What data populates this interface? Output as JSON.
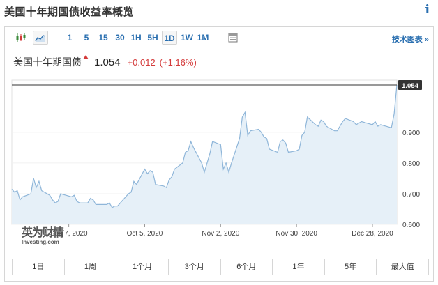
{
  "page": {
    "title": "美国十年期国债收益率概览",
    "info_icon": "i"
  },
  "toolbar": {
    "chart_type_icons": [
      "candlestick-icon",
      "area-chart-icon"
    ],
    "timeframes": [
      "1",
      "5",
      "15",
      "30",
      "1H",
      "5H",
      "1D",
      "1W",
      "1M"
    ],
    "active_timeframe": "1D",
    "settings_icon": "table-icon",
    "tech_chart_label": "技术图表 »"
  },
  "quote": {
    "name": "美国十年期国债",
    "price": "1.054",
    "change": "+0.012",
    "change_pct": "(+1.16%)",
    "direction": "up"
  },
  "watermark": {
    "cn": "英为财情",
    "en": "Investing.com"
  },
  "range_buttons": [
    "1日",
    "1周",
    "1个月",
    "3个月",
    "6个月",
    "1年",
    "5年",
    "最大值"
  ],
  "colors": {
    "up": "#d43a3a",
    "link": "#2a6fb0",
    "line": "#8fb6d9",
    "area": "#e6f0f8"
  },
  "chart_data": {
    "type": "area",
    "title": "",
    "xlabel": "",
    "ylabel": "",
    "ylim": [
      0.6,
      1.07
    ],
    "y_ticks": [
      0.6,
      0.7,
      0.8,
      0.9
    ],
    "y_tick_labels": [
      "0.600",
      "0.700",
      "0.800",
      "0.900"
    ],
    "x_ticks": [
      "2020-09-07",
      "2020-10-05",
      "2020-11-02",
      "2020-11-30",
      "2020-12-28"
    ],
    "x_tick_labels": [
      "Sep 7, 2020",
      "Oct 5, 2020",
      "Nov 2, 2020",
      "Nov 30, 2020",
      "Dec 28, 2020"
    ],
    "last_value_label": "1.054",
    "reference_line": 1.054,
    "series": [
      {
        "x": [
          "2020-08-17",
          "2020-08-18",
          "2020-08-19",
          "2020-08-20",
          "2020-08-21",
          "2020-08-24",
          "2020-08-25",
          "2020-08-26",
          "2020-08-27",
          "2020-08-28",
          "2020-08-31",
          "2020-09-01",
          "2020-09-02",
          "2020-09-03",
          "2020-09-04",
          "2020-09-08",
          "2020-09-09",
          "2020-09-10",
          "2020-09-11",
          "2020-09-14",
          "2020-09-15",
          "2020-09-16",
          "2020-09-17",
          "2020-09-18",
          "2020-09-21",
          "2020-09-22",
          "2020-09-23",
          "2020-09-24",
          "2020-09-25",
          "2020-09-28",
          "2020-09-29",
          "2020-09-30",
          "2020-10-01",
          "2020-10-02",
          "2020-10-05",
          "2020-10-06",
          "2020-10-07",
          "2020-10-08",
          "2020-10-09",
          "2020-10-12",
          "2020-10-13",
          "2020-10-14",
          "2020-10-15",
          "2020-10-16",
          "2020-10-19",
          "2020-10-20",
          "2020-10-21",
          "2020-10-22",
          "2020-10-23",
          "2020-10-26",
          "2020-10-27",
          "2020-10-28",
          "2020-10-29",
          "2020-10-30",
          "2020-11-02",
          "2020-11-03",
          "2020-11-04",
          "2020-11-05",
          "2020-11-06",
          "2020-11-09",
          "2020-11-10",
          "2020-11-11",
          "2020-11-12",
          "2020-11-13",
          "2020-11-16",
          "2020-11-17",
          "2020-11-18",
          "2020-11-19",
          "2020-11-20",
          "2020-11-23",
          "2020-11-24",
          "2020-11-25",
          "2020-11-26",
          "2020-11-27",
          "2020-11-30",
          "2020-12-01",
          "2020-12-02",
          "2020-12-03",
          "2020-12-04",
          "2020-12-07",
          "2020-12-08",
          "2020-12-09",
          "2020-12-10",
          "2020-12-11",
          "2020-12-14",
          "2020-12-15",
          "2020-12-16",
          "2020-12-17",
          "2020-12-18",
          "2020-12-21",
          "2020-12-22",
          "2020-12-23",
          "2020-12-24",
          "2020-12-28",
          "2020-12-29",
          "2020-12-30",
          "2020-12-31",
          "2021-01-04",
          "2021-01-05",
          "2021-01-06"
        ],
        "y": [
          0.715,
          0.705,
          0.71,
          0.68,
          0.69,
          0.7,
          0.75,
          0.72,
          0.74,
          0.71,
          0.695,
          0.68,
          0.67,
          0.675,
          0.7,
          0.69,
          0.695,
          0.675,
          0.67,
          0.67,
          0.685,
          0.68,
          0.665,
          0.665,
          0.665,
          0.67,
          0.655,
          0.66,
          0.66,
          0.69,
          0.7,
          0.705,
          0.74,
          0.73,
          0.78,
          0.765,
          0.775,
          0.77,
          0.73,
          0.725,
          0.72,
          0.745,
          0.755,
          0.78,
          0.8,
          0.835,
          0.84,
          0.87,
          0.85,
          0.8,
          0.77,
          0.8,
          0.83,
          0.87,
          0.86,
          0.78,
          0.8,
          0.77,
          0.8,
          0.88,
          0.95,
          0.965,
          0.89,
          0.905,
          0.91,
          0.9,
          0.885,
          0.88,
          0.845,
          0.835,
          0.87,
          0.875,
          0.865,
          0.835,
          0.84,
          0.845,
          0.89,
          0.9,
          0.95,
          0.925,
          0.92,
          0.94,
          0.935,
          0.92,
          0.905,
          0.905,
          0.92,
          0.935,
          0.945,
          0.935,
          0.925,
          0.93,
          0.935,
          0.925,
          0.935,
          0.92,
          0.925,
          0.915,
          0.96,
          1.054
        ]
      }
    ]
  }
}
